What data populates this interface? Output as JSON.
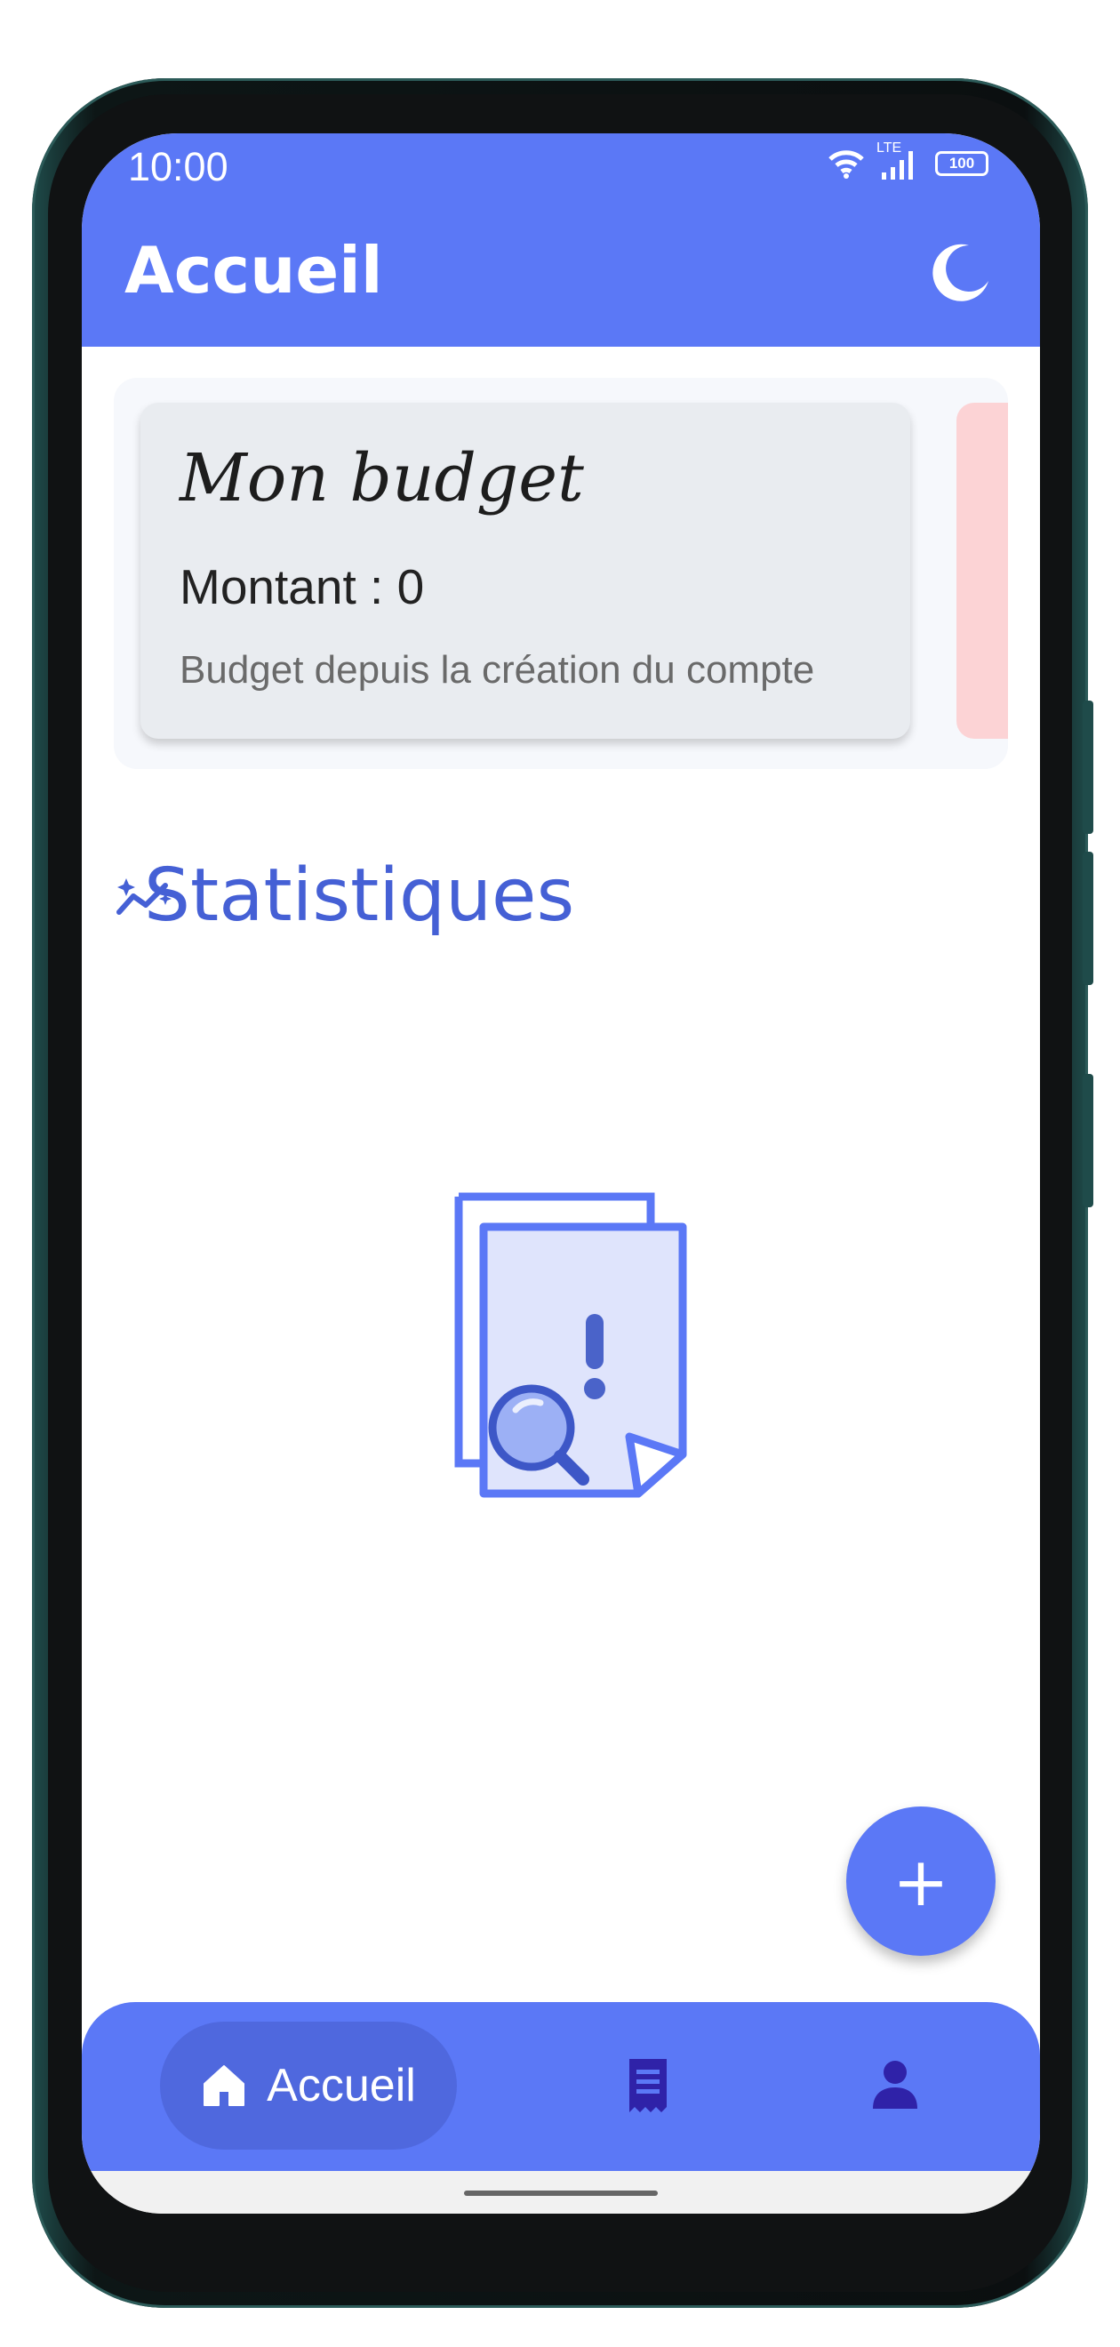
{
  "status_bar": {
    "time": "10:00",
    "network": "LTE",
    "battery": "100"
  },
  "header": {
    "title": "Accueil",
    "theme_toggle_icon": "moon-icon"
  },
  "budget_card": {
    "title": "Mon budget",
    "amount": "Montant : 0",
    "description": "Budget depuis la création du compte"
  },
  "statistics": {
    "title": "Statistiques",
    "icon": "sparkline-icon",
    "empty_state_icon": "document-search-warning-icon"
  },
  "fab": {
    "label": "+"
  },
  "bottom_nav": {
    "items": [
      {
        "label": "Accueil",
        "icon": "home-icon",
        "active": true
      },
      {
        "label": "",
        "icon": "receipt-icon",
        "active": false
      },
      {
        "label": "",
        "icon": "user-icon",
        "active": false
      }
    ]
  },
  "colors": {
    "primary": "#5b78f6",
    "primary_dark": "#4560d5",
    "nav_icon": "#2f22a8",
    "card_bg": "#e9ecf0",
    "peek_card": "#fcd3d5"
  }
}
